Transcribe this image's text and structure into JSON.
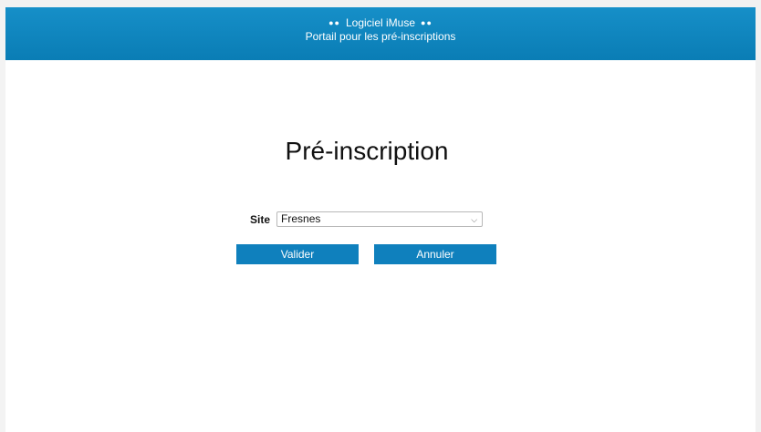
{
  "header": {
    "dots_left": "●●",
    "title": "Logiciel iMuse",
    "dots_right": "●●",
    "subtitle": "Portail pour les pré-inscriptions"
  },
  "main": {
    "title": "Pré-inscription",
    "site_label": "Site",
    "site_selected": "Fresnes",
    "buttons": {
      "validate": "Valider",
      "cancel": "Annuler"
    }
  },
  "colors": {
    "header_bg": "#0f86c2",
    "button_bg": "#0f80bd"
  }
}
